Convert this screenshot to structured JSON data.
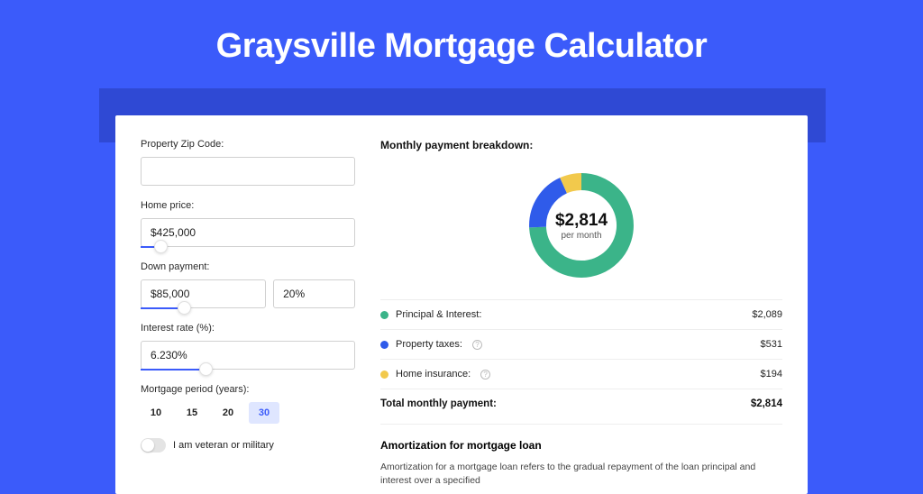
{
  "page_title": "Graysville Mortgage Calculator",
  "form": {
    "zip": {
      "label": "Property Zip Code:",
      "value": ""
    },
    "home_price": {
      "label": "Home price:",
      "value": "$425,000"
    },
    "down_payment": {
      "label": "Down payment:",
      "amount": "$85,000",
      "percent": "20%"
    },
    "interest_rate": {
      "label": "Interest rate (%):",
      "value": "6.230%"
    },
    "period": {
      "label": "Mortgage period (years):",
      "options": [
        "10",
        "15",
        "20",
        "30"
      ],
      "selected": "30"
    },
    "veteran": {
      "label": "I am veteran or military",
      "checked": false
    }
  },
  "breakdown": {
    "title": "Monthly payment breakdown:",
    "center_amount": "$2,814",
    "center_label": "per month",
    "items": [
      {
        "label": "Principal & Interest:",
        "value": "$2,089"
      },
      {
        "label": "Property taxes:",
        "value": "$531",
        "info": true
      },
      {
        "label": "Home insurance:",
        "value": "$194",
        "info": true
      }
    ],
    "total_label": "Total monthly payment:",
    "total_value": "$2,814"
  },
  "amortization": {
    "title": "Amortization for mortgage loan",
    "body": "Amortization for a mortgage loan refers to the gradual repayment of the loan principal and interest over a specified"
  },
  "chart_data": {
    "type": "pie",
    "title": "Monthly payment breakdown",
    "series": [
      {
        "name": "Principal & Interest",
        "value": 2089,
        "color": "#3BB489"
      },
      {
        "name": "Property taxes",
        "value": 531,
        "color": "#2F5BEA"
      },
      {
        "name": "Home insurance",
        "value": 194,
        "color": "#F2C94C"
      }
    ],
    "total": 2814,
    "unit": "USD per month"
  }
}
